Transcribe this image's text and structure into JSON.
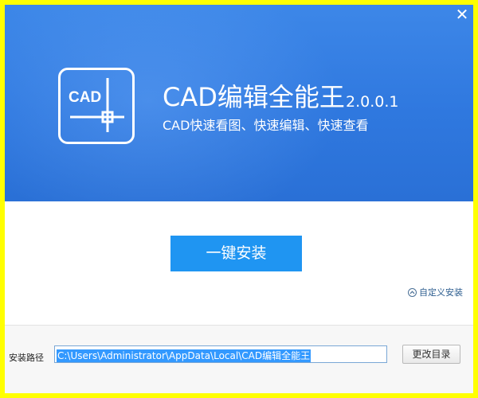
{
  "header": {
    "close_glyph": "✕",
    "logo_text": "CAD",
    "title": "CAD编辑全能王",
    "version": "2.0.0.1",
    "tagline": "CAD快速看图、快速编辑、快速查看"
  },
  "main": {
    "install_label": "一键安装",
    "custom_install_label": "自定义安装"
  },
  "footer": {
    "path_label": "安装路径",
    "path_value": "C:\\Users\\Administrator\\AppData\\Local\\CAD编辑全能王",
    "browse_label": "更改目录"
  },
  "colors": {
    "header_blue": "#2f78df",
    "install_button": "#1f95f2",
    "frame_border": "#ffff00",
    "selection": "#3399ff"
  },
  "icons": {
    "close": "close-icon",
    "logo": "cad-crosshair-logo-icon",
    "custom_install": "chevron-up-circle-icon"
  }
}
